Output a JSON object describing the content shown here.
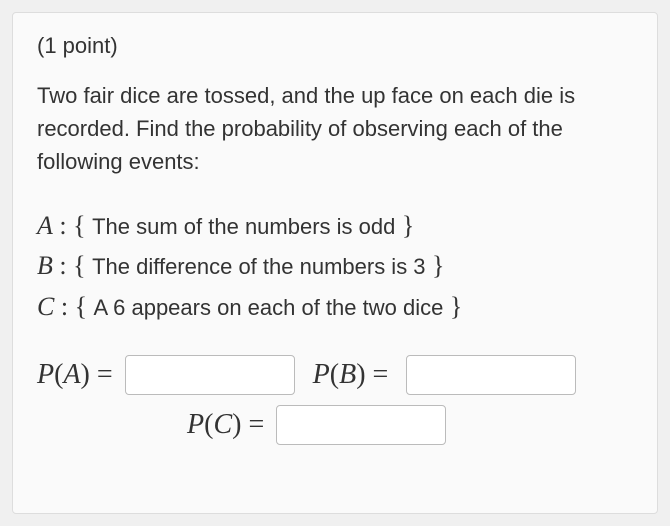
{
  "points": "(1 point)",
  "prompt": "Two fair dice are tossed, and the up face on each die is recorded. Find the probability of observing each of the following events:",
  "events": {
    "A": {
      "var": "A",
      "sep": " : { ",
      "desc": "The sum of the numbers is odd",
      "close": " }"
    },
    "B": {
      "var": "B",
      "sep": " : { ",
      "desc": "The difference of the numbers is 3",
      "close": " }"
    },
    "C": {
      "var": "C",
      "sep": " : { ",
      "desc": "A 6 appears on each of the two dice",
      "close": " }"
    }
  },
  "answers": {
    "A": {
      "P": "P",
      "open": "(",
      "var": "A",
      "close": ")",
      "eq": " = ",
      "value": ""
    },
    "B": {
      "P": "P",
      "open": "(",
      "var": "B",
      "close": ")",
      "eq": " = ",
      "value": ""
    },
    "C": {
      "P": "P",
      "open": "(",
      "var": "C",
      "close": ")",
      "eq": " = ",
      "value": ""
    }
  }
}
